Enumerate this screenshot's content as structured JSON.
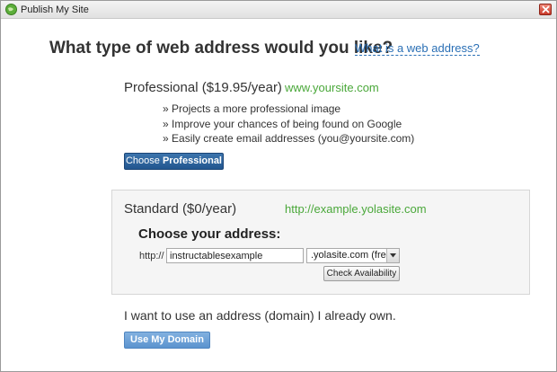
{
  "window": {
    "title": "Publish My Site",
    "icons": {
      "app": "yola-globe-icon",
      "close": "close-icon"
    }
  },
  "page": {
    "heading": "What type of web address would you like?",
    "help_link": "What is a web address?"
  },
  "professional": {
    "name": "Professional ($19.95/year)",
    "url_example": "www.yoursite.com",
    "features": [
      "Projects a more professional image",
      "Improve your chances of being found on Google",
      "Easily create email addresses (you@yoursite.com)"
    ],
    "button_prefix": "Choose",
    "button_strong": "Professional"
  },
  "standard": {
    "name": "Standard ($0/year)",
    "url_example": "http://example.yolasite.com",
    "choose_label": "Choose your address:",
    "prefix": "http://",
    "address_value": "instructablesexample",
    "domain_selected": ".yolasite.com (free)",
    "check_button": "Check Availability"
  },
  "own_domain": {
    "text": "I want to use an address (domain) I already own.",
    "button": "Use My Domain"
  },
  "colors": {
    "link": "#2a6fb5",
    "url_green": "#4aa83a",
    "primary_button": "#2c5f97",
    "secondary_button": "#6ea3d8"
  }
}
